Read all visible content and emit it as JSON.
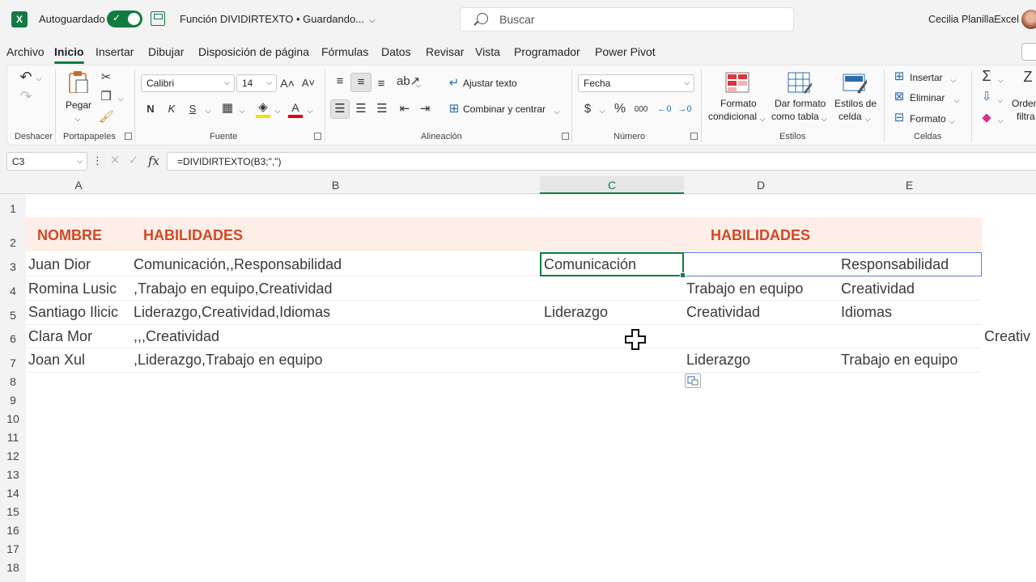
{
  "titlebar": {
    "app_logo": "X",
    "autosave_label": "Autoguardado",
    "doc_title": "Función DIVIDIRTEXTO • Guardando...",
    "search_placeholder": "Buscar",
    "user_name": "Cecilia PlanillaExcel"
  },
  "tabs": [
    "Archivo",
    "Inicio",
    "Insertar",
    "Dibujar",
    "Disposición de página",
    "Fórmulas",
    "Datos",
    "Revisar",
    "Vista",
    "Programador",
    "Power Pivot"
  ],
  "active_tab": "Inicio",
  "ribbon": {
    "groups": {
      "undo": "Deshacer",
      "clipboard": "Portapapeles",
      "font": "Fuente",
      "alignment": "Alineación",
      "number": "Número",
      "styles": "Estilos",
      "cells": "Celdas"
    },
    "paste_label": "Pegar",
    "font_name": "Calibri",
    "font_size": "14",
    "bold": "N",
    "italic": "K",
    "underline": "S",
    "wrap_text": "Ajustar texto",
    "merge_center": "Combinar y centrar",
    "number_format": "Fecha",
    "currency": "$",
    "percent": "%",
    "thousands": "000",
    "conditional_format": [
      "Formato",
      "condicional"
    ],
    "format_table": [
      "Dar formato",
      "como tabla"
    ],
    "cell_styles": [
      "Estilos de",
      "celda"
    ],
    "insert": "Insertar",
    "delete": "Eliminar",
    "format": "Formato",
    "sort_filter": [
      "Orden",
      "filtra"
    ]
  },
  "formula_bar": {
    "name_box": "C3",
    "fx": "fx",
    "formula": "=DIVIDIRTEXTO(B3;\",\")"
  },
  "columns": [
    "A",
    "B",
    "C",
    "D",
    "E"
  ],
  "rows": [
    "1",
    "2",
    "3",
    "4",
    "5",
    "6",
    "7",
    "8",
    "9",
    "10",
    "11",
    "12",
    "13",
    "14",
    "15",
    "16",
    "17",
    "18"
  ],
  "sheet": {
    "header_nombre": "NOMBRE",
    "header_habilidades": "HABILIDADES",
    "header_habilidades_right": "HABILIDADES",
    "data": [
      {
        "a": "Juan Dior",
        "b": "Comunicación,,Responsabilidad",
        "c": "Comunicación",
        "d": "",
        "e": "Responsabilidad",
        "f": ""
      },
      {
        "a": "Romina Lusic",
        "b": ",Trabajo en equipo,Creatividad",
        "c": "",
        "d": "Trabajo en equipo",
        "e": "Creatividad",
        "f": ""
      },
      {
        "a": "Santiago Ilicic",
        "b": "Liderazgo,Creatividad,Idiomas",
        "c": "Liderazgo",
        "d": "Creatividad",
        "e": "Idiomas",
        "f": ""
      },
      {
        "a": "Clara Mor",
        "b": ",,,Creatividad",
        "c": "",
        "d": "",
        "e": "",
        "f": "Creativ"
      },
      {
        "a": "Joan Xul",
        "b": ",Liderazgo,Trabajo en equipo",
        "c": "",
        "d": "Liderazgo",
        "e": "Trabajo en equipo",
        "f": ""
      }
    ]
  }
}
